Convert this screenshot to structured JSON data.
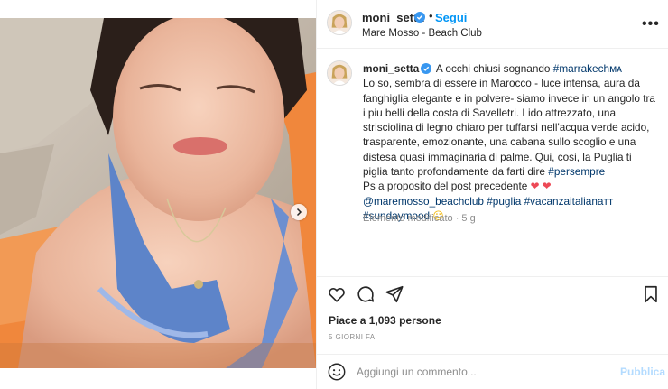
{
  "post": {
    "username": "moni_setta",
    "follow_separator": "•",
    "follow_label": "Segui",
    "location": "Mare Mosso - Beach Club",
    "more_icon": "•••"
  },
  "caption": {
    "username": "moni_setta",
    "first_line": "A occhi chiusi sognando",
    "hashtag_1": "#marrakechᴍᴀ",
    "body": "Lo so, sembra di essere in Marocco - luce intensa, aura da fanghiglia elegante e in polvere- siamo invece in un angolo tra i piu belli della costa di Savelletri. Lido attrezzato, una strisciolina di legno chiaro per tuffarsi nell'acqua verde acido, trasparente, emozionante, una cabana sullo scoglio e una distesa quasi immaginaria di palme. Qui, cosi, la Puglia ti piglia tanto profondamente da farti dire",
    "hashtag_2": "#persempre",
    "ps": "Ps a proposito del post precedente",
    "hearts": "❤ ❤",
    "mention": "@maremosso_beachclub",
    "hashtag_3": "#puglia",
    "hashtag_4": "#vacanzaitalianaᴛᴛ",
    "hashtag_5": "#sundaymood",
    "sun_emoji": "😐",
    "meta": "Elemento modificato · 5 g"
  },
  "engagement": {
    "likes": "Piace a 1,093 persone",
    "time_ago": "5 GIORNI FA"
  },
  "comment": {
    "placeholder": "Aggiungi un commento...",
    "publish_label": "Pubblica"
  },
  "colors": {
    "accent": "#0095f6",
    "link": "#00376b",
    "heart": "#ed4956",
    "muted": "#8e8e8e"
  },
  "icons": [
    "verified-icon",
    "more-options-icon",
    "heart-icon",
    "comment-icon",
    "share-icon",
    "bookmark-icon",
    "emoji-icon",
    "chevron-right-icon"
  ]
}
